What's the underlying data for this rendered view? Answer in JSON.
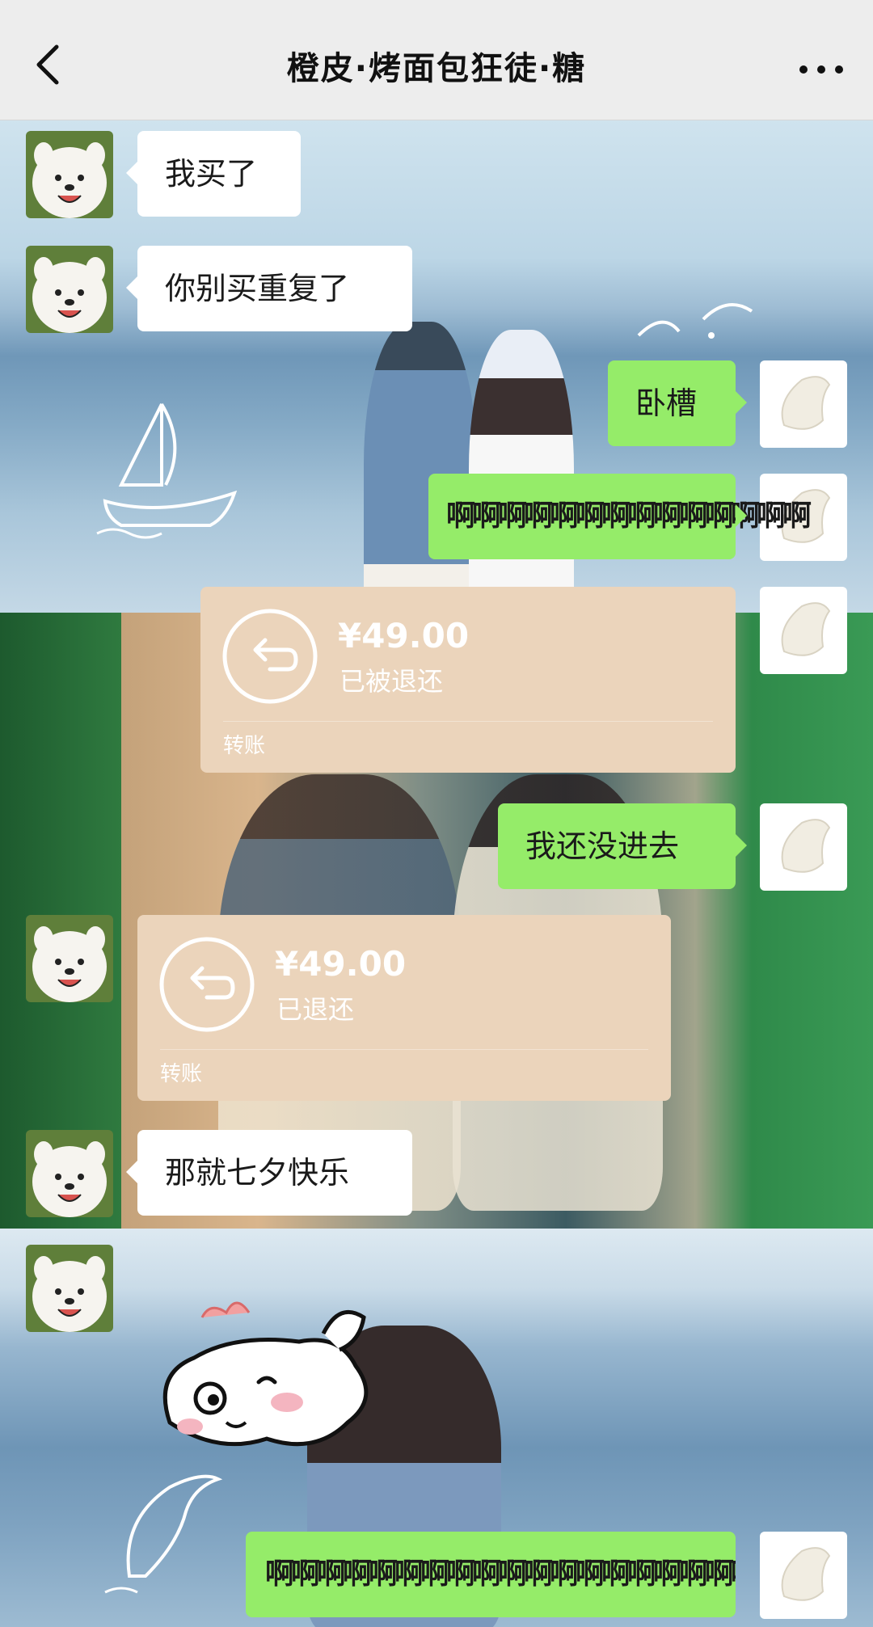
{
  "header": {
    "title": "橙皮·烤面包狂徒·糖"
  },
  "messages": [
    {
      "side": "left",
      "text": "我买了"
    },
    {
      "side": "left",
      "text": "你别买重复了"
    },
    {
      "side": "right",
      "text": "卧槽"
    },
    {
      "side": "right",
      "text": "啊啊啊啊啊啊啊啊啊啊啊啊啊啊"
    },
    {
      "side": "right",
      "type": "transfer",
      "amount": "¥49.00",
      "status": "已被退还",
      "label": "转账"
    },
    {
      "side": "right",
      "text": "我还没进去"
    },
    {
      "side": "left",
      "type": "transfer",
      "amount": "¥49.00",
      "status": "已退还",
      "label": "转账"
    },
    {
      "side": "left",
      "text": "那就七夕快乐"
    },
    {
      "side": "left",
      "type": "sticker"
    },
    {
      "side": "right",
      "text": "啊啊啊啊啊啊啊啊啊啊啊啊啊啊啊啊啊啊啊啊啊啊啊啊啊啊啊啊"
    }
  ],
  "colors": {
    "header_bg": "#ededed",
    "sent_bubble": "#95ec69",
    "received_bubble": "#ffffff",
    "transfer_card": "#ebd4bb"
  },
  "icons": {
    "back": "chevron-left-icon",
    "more": "more-dots-icon",
    "transfer": "return-arrow-icon"
  }
}
